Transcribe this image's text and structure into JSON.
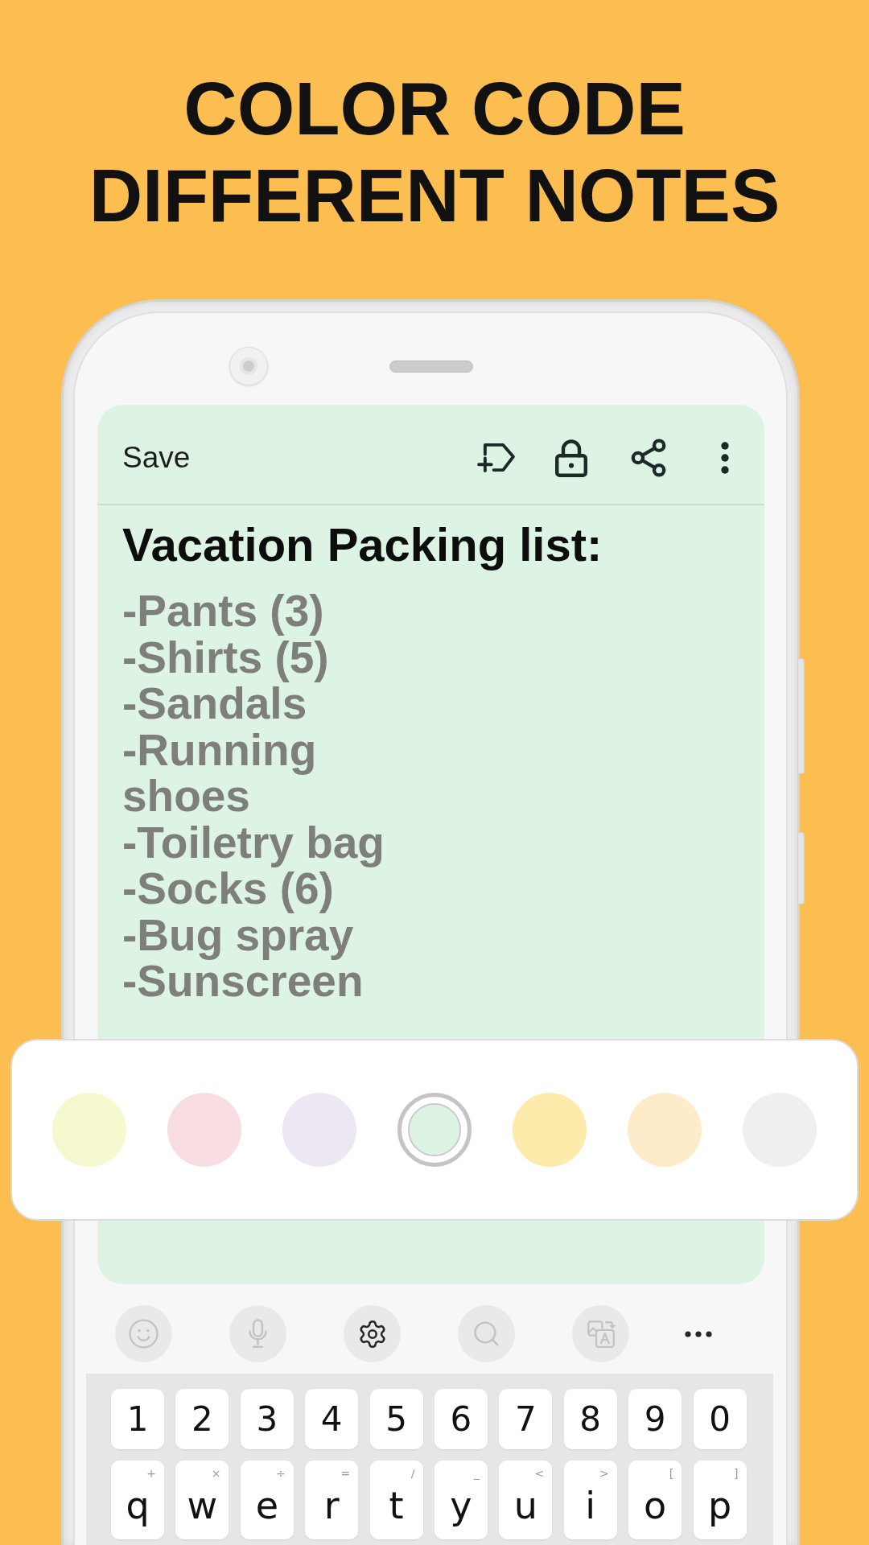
{
  "headline": [
    "COLOR CODE",
    "DIFFERENT NOTES"
  ],
  "note": {
    "save": "Save",
    "title": "Vacation Packing list:",
    "items": [
      "-Pants (3)",
      "-Shirts (5)",
      "-Sandals",
      "-Running shoes",
      "-Toiletry bag",
      "-Socks (6)",
      "-Bug spray",
      "-Sunscreen"
    ]
  },
  "palette": [
    {
      "color": "#f6f8cf",
      "selected": false
    },
    {
      "color": "#f8dee3",
      "selected": false
    },
    {
      "color": "#ede6f3",
      "selected": false
    },
    {
      "color": "#ddf4e4",
      "selected": true
    },
    {
      "color": "#fcebab",
      "selected": false
    },
    {
      "color": "#feebca",
      "selected": false
    },
    {
      "color": "#efefef",
      "selected": false
    }
  ],
  "keyboard_toolbar": [
    {
      "kind": "emoji",
      "disabled": true
    },
    {
      "kind": "voice",
      "disabled": true
    },
    {
      "kind": "settings",
      "disabled": false
    },
    {
      "kind": "search",
      "disabled": true
    },
    {
      "kind": "translate",
      "disabled": true
    },
    {
      "kind": "more",
      "disabled": false
    }
  ],
  "keyboard": {
    "number_row": [
      "1",
      "2",
      "3",
      "4",
      "5",
      "6",
      "7",
      "8",
      "9",
      "0"
    ],
    "letter_row": [
      {
        "label": "q",
        "hint": "+"
      },
      {
        "label": "w",
        "hint": "×"
      },
      {
        "label": "e",
        "hint": "÷"
      },
      {
        "label": "r",
        "hint": "="
      },
      {
        "label": "t",
        "hint": "/"
      },
      {
        "label": "y",
        "hint": "_"
      },
      {
        "label": "u",
        "hint": "<"
      },
      {
        "label": "i",
        "hint": ">"
      },
      {
        "label": "o",
        "hint": "["
      },
      {
        "label": "p",
        "hint": "]"
      }
    ]
  }
}
